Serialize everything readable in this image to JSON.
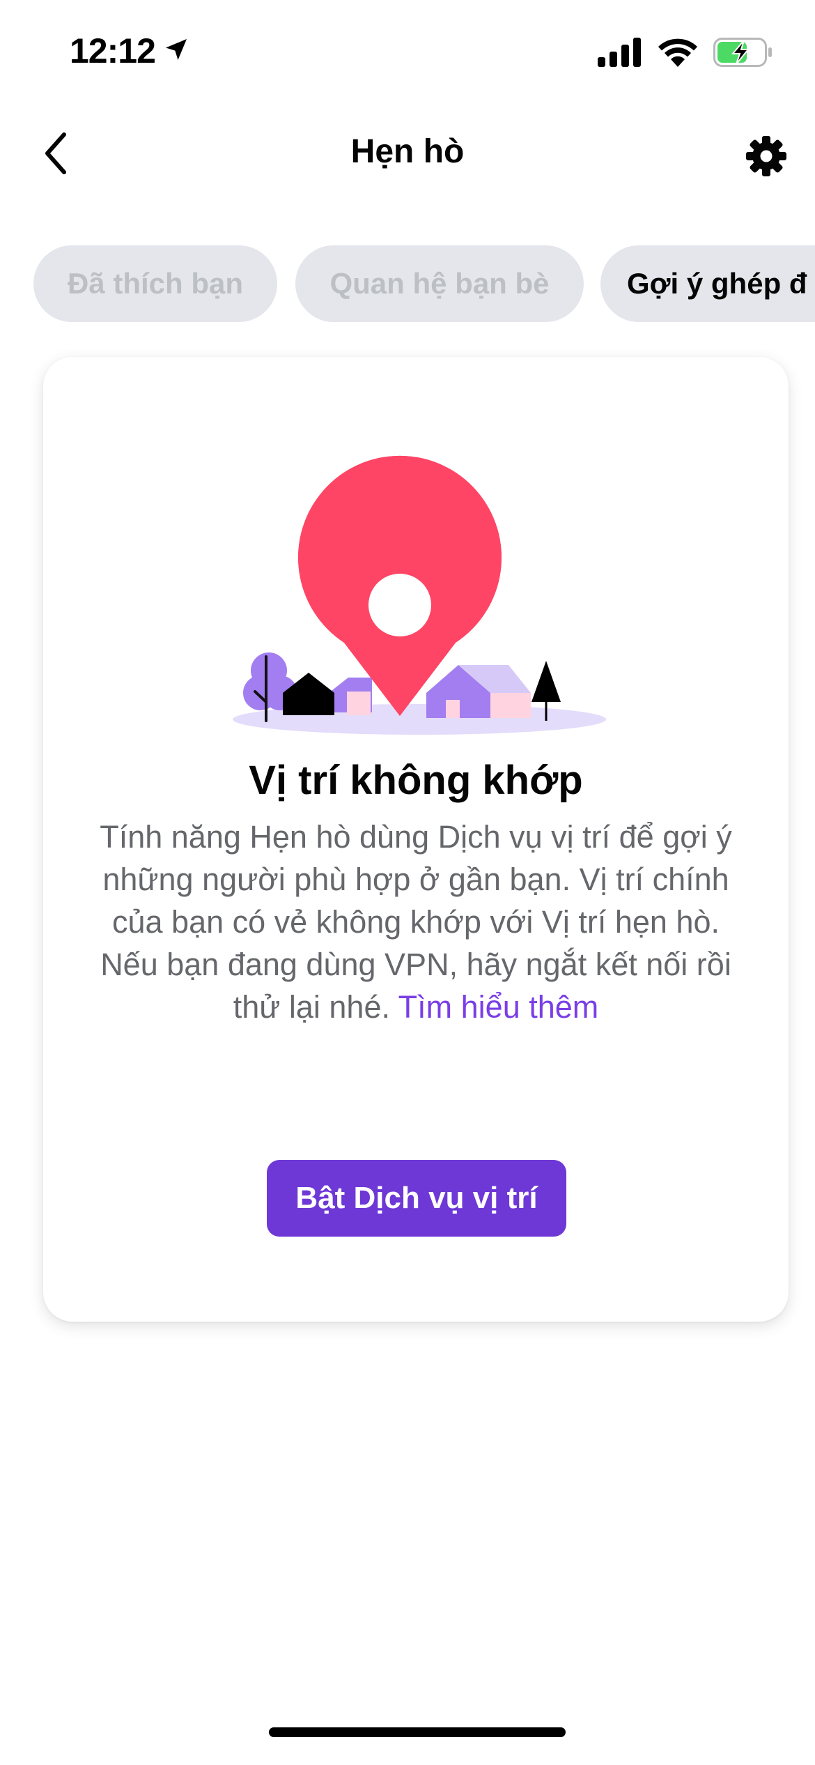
{
  "status_bar": {
    "time": "12:12"
  },
  "header": {
    "title": "Hẹn hò"
  },
  "chips": [
    {
      "label": "Đã thích bạn",
      "active": false
    },
    {
      "label": "Quan hệ bạn bè",
      "active": false
    },
    {
      "label": "Gợi ý ghép đ",
      "active": true
    }
  ],
  "card": {
    "title": "Vị trí không khớp",
    "body": "Tính năng Hẹn hò dùng Dịch vụ vị trí để gợi ý những người phù hợp ở gần bạn. Vị trí chính của bạn có vẻ không khớp với Vị trí hẹn hò. Nếu bạn đang dùng VPN, hãy ngắt kết nối rồi thử lại nhé.",
    "learn_more": "Tìm hiểu thêm",
    "button_label": "Bật Dịch vụ vị trí"
  },
  "colors": {
    "accent": "#6e38d6",
    "link": "#7a3ee6",
    "pin": "#ff4565",
    "chip_bg": "#e4e6eb",
    "battery_green": "#4cd964"
  },
  "icons": {
    "location_arrow": "location-arrow-icon",
    "signal": "cellular-signal-icon",
    "wifi": "wifi-icon",
    "battery": "battery-charging-icon",
    "back": "chevron-left-icon",
    "settings": "gear-icon"
  }
}
